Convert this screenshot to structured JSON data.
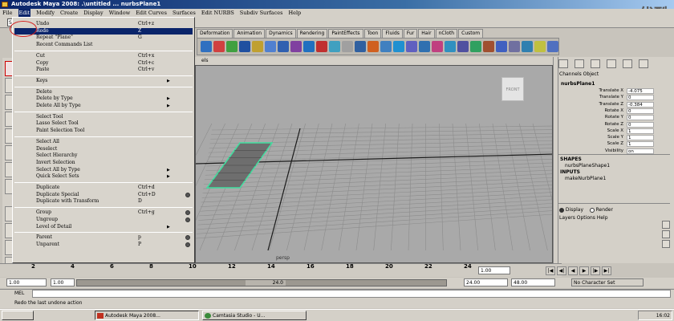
{
  "window": {
    "title": "Autodesk Maya 2008: .\\untitled    ...   nurbsPlane1"
  },
  "watermark": "优酷",
  "menubar": {
    "items": [
      "File",
      "Edit",
      "Modify",
      "Create",
      "Display",
      "Window",
      "Edit Curves",
      "Surfaces",
      "Edit NURBS",
      "Subdiv Surfaces",
      "Help"
    ]
  },
  "status": {
    "mode": "Surf"
  },
  "shelf": {
    "tabs": [
      "Deformation",
      "Animation",
      "Dynamics",
      "Rendering",
      "PaintEffects",
      "Toon",
      "Fluids",
      "Fur",
      "Hair",
      "nCloth",
      "Custom"
    ]
  },
  "edit_menu": {
    "items": [
      {
        "label": "Undo",
        "shortcut": "Ctrl+z"
      },
      {
        "label": "Redo",
        "shortcut": "Z",
        "highlighted": true
      },
      {
        "label": "Repeat \"Plane\"",
        "shortcut": "G"
      },
      {
        "label": "Recent Commands List"
      },
      {
        "label": "Cut",
        "shortcut": "Ctrl+x"
      },
      {
        "label": "Copy",
        "shortcut": "Ctrl+c"
      },
      {
        "label": "Paste",
        "shortcut": "Ctrl+v"
      },
      {
        "label": "Keys",
        "submenu": true
      },
      {
        "label": "Delete"
      },
      {
        "label": "Delete by Type",
        "submenu": true
      },
      {
        "label": "Delete All by Type",
        "submenu": true
      },
      {
        "label": "Select Tool"
      },
      {
        "label": "Lasso Select Tool"
      },
      {
        "label": "Paint Selection Tool"
      },
      {
        "label": "Select All"
      },
      {
        "label": "Deselect"
      },
      {
        "label": "Select Hierarchy"
      },
      {
        "label": "Invert Selection"
      },
      {
        "label": "Select All by Type",
        "submenu": true
      },
      {
        "label": "Quick Select Sets",
        "submenu": true
      },
      {
        "label": "Duplicate",
        "shortcut": "Ctrl+d"
      },
      {
        "label": "Duplicate Special",
        "shortcut": "Ctrl+D",
        "option": true
      },
      {
        "label": "Duplicate with Transform",
        "shortcut": "D"
      },
      {
        "label": "Group",
        "shortcut": "Ctrl+g",
        "option": true
      },
      {
        "label": "Ungroup",
        "option": true
      },
      {
        "label": "Level of Detail",
        "submenu": true
      },
      {
        "label": "Parent",
        "shortcut": "p",
        "option": true
      },
      {
        "label": "Unparent",
        "shortcut": "P",
        "option": true
      }
    ]
  },
  "viewport": {
    "camera_label": "persp",
    "panel_menu_text": "els",
    "viewcube_face": "FRONT"
  },
  "channel_box": {
    "header": "Channels  Object",
    "object_name": "nurbsPlane1",
    "attributes": [
      {
        "label": "Translate X",
        "value": "-4.075"
      },
      {
        "label": "Translate Y",
        "value": "0"
      },
      {
        "label": "Translate Z",
        "value": "-0.384"
      },
      {
        "label": "Rotate X",
        "value": "0"
      },
      {
        "label": "Rotate Y",
        "value": "0"
      },
      {
        "label": "Rotate Z",
        "value": "0"
      },
      {
        "label": "Scale X",
        "value": "1"
      },
      {
        "label": "Scale Y",
        "value": "1"
      },
      {
        "label": "Scale Z",
        "value": "1"
      },
      {
        "label": "Visibility",
        "value": "on"
      }
    ],
    "shapes_label": "SHAPES",
    "shape_name": "nurbsPlaneShape1",
    "inputs_label": "INPUTS",
    "input_name": "makeNurbPlane1"
  },
  "layer_editor": {
    "display_label": "Display",
    "render_label": "Render",
    "menu": "Layers  Options  Help"
  },
  "timeline": {
    "ticks": [
      "2",
      "4",
      "6",
      "8",
      "10",
      "12",
      "14",
      "16",
      "18",
      "20",
      "22",
      "24"
    ],
    "current_frame": "1.00",
    "start": "1.00",
    "playback_start": "1.00",
    "range_label": "24.0",
    "playback_end": "24.00",
    "end": "48.00",
    "character_set": "No Character Set"
  },
  "mel": {
    "label": "MEL",
    "value": ""
  },
  "help_line": "Redo the last undone action",
  "taskbar": {
    "items": [
      "Autodesk Maya 2008...",
      "Camtasia Studio - U..."
    ],
    "clock": "16:02"
  }
}
